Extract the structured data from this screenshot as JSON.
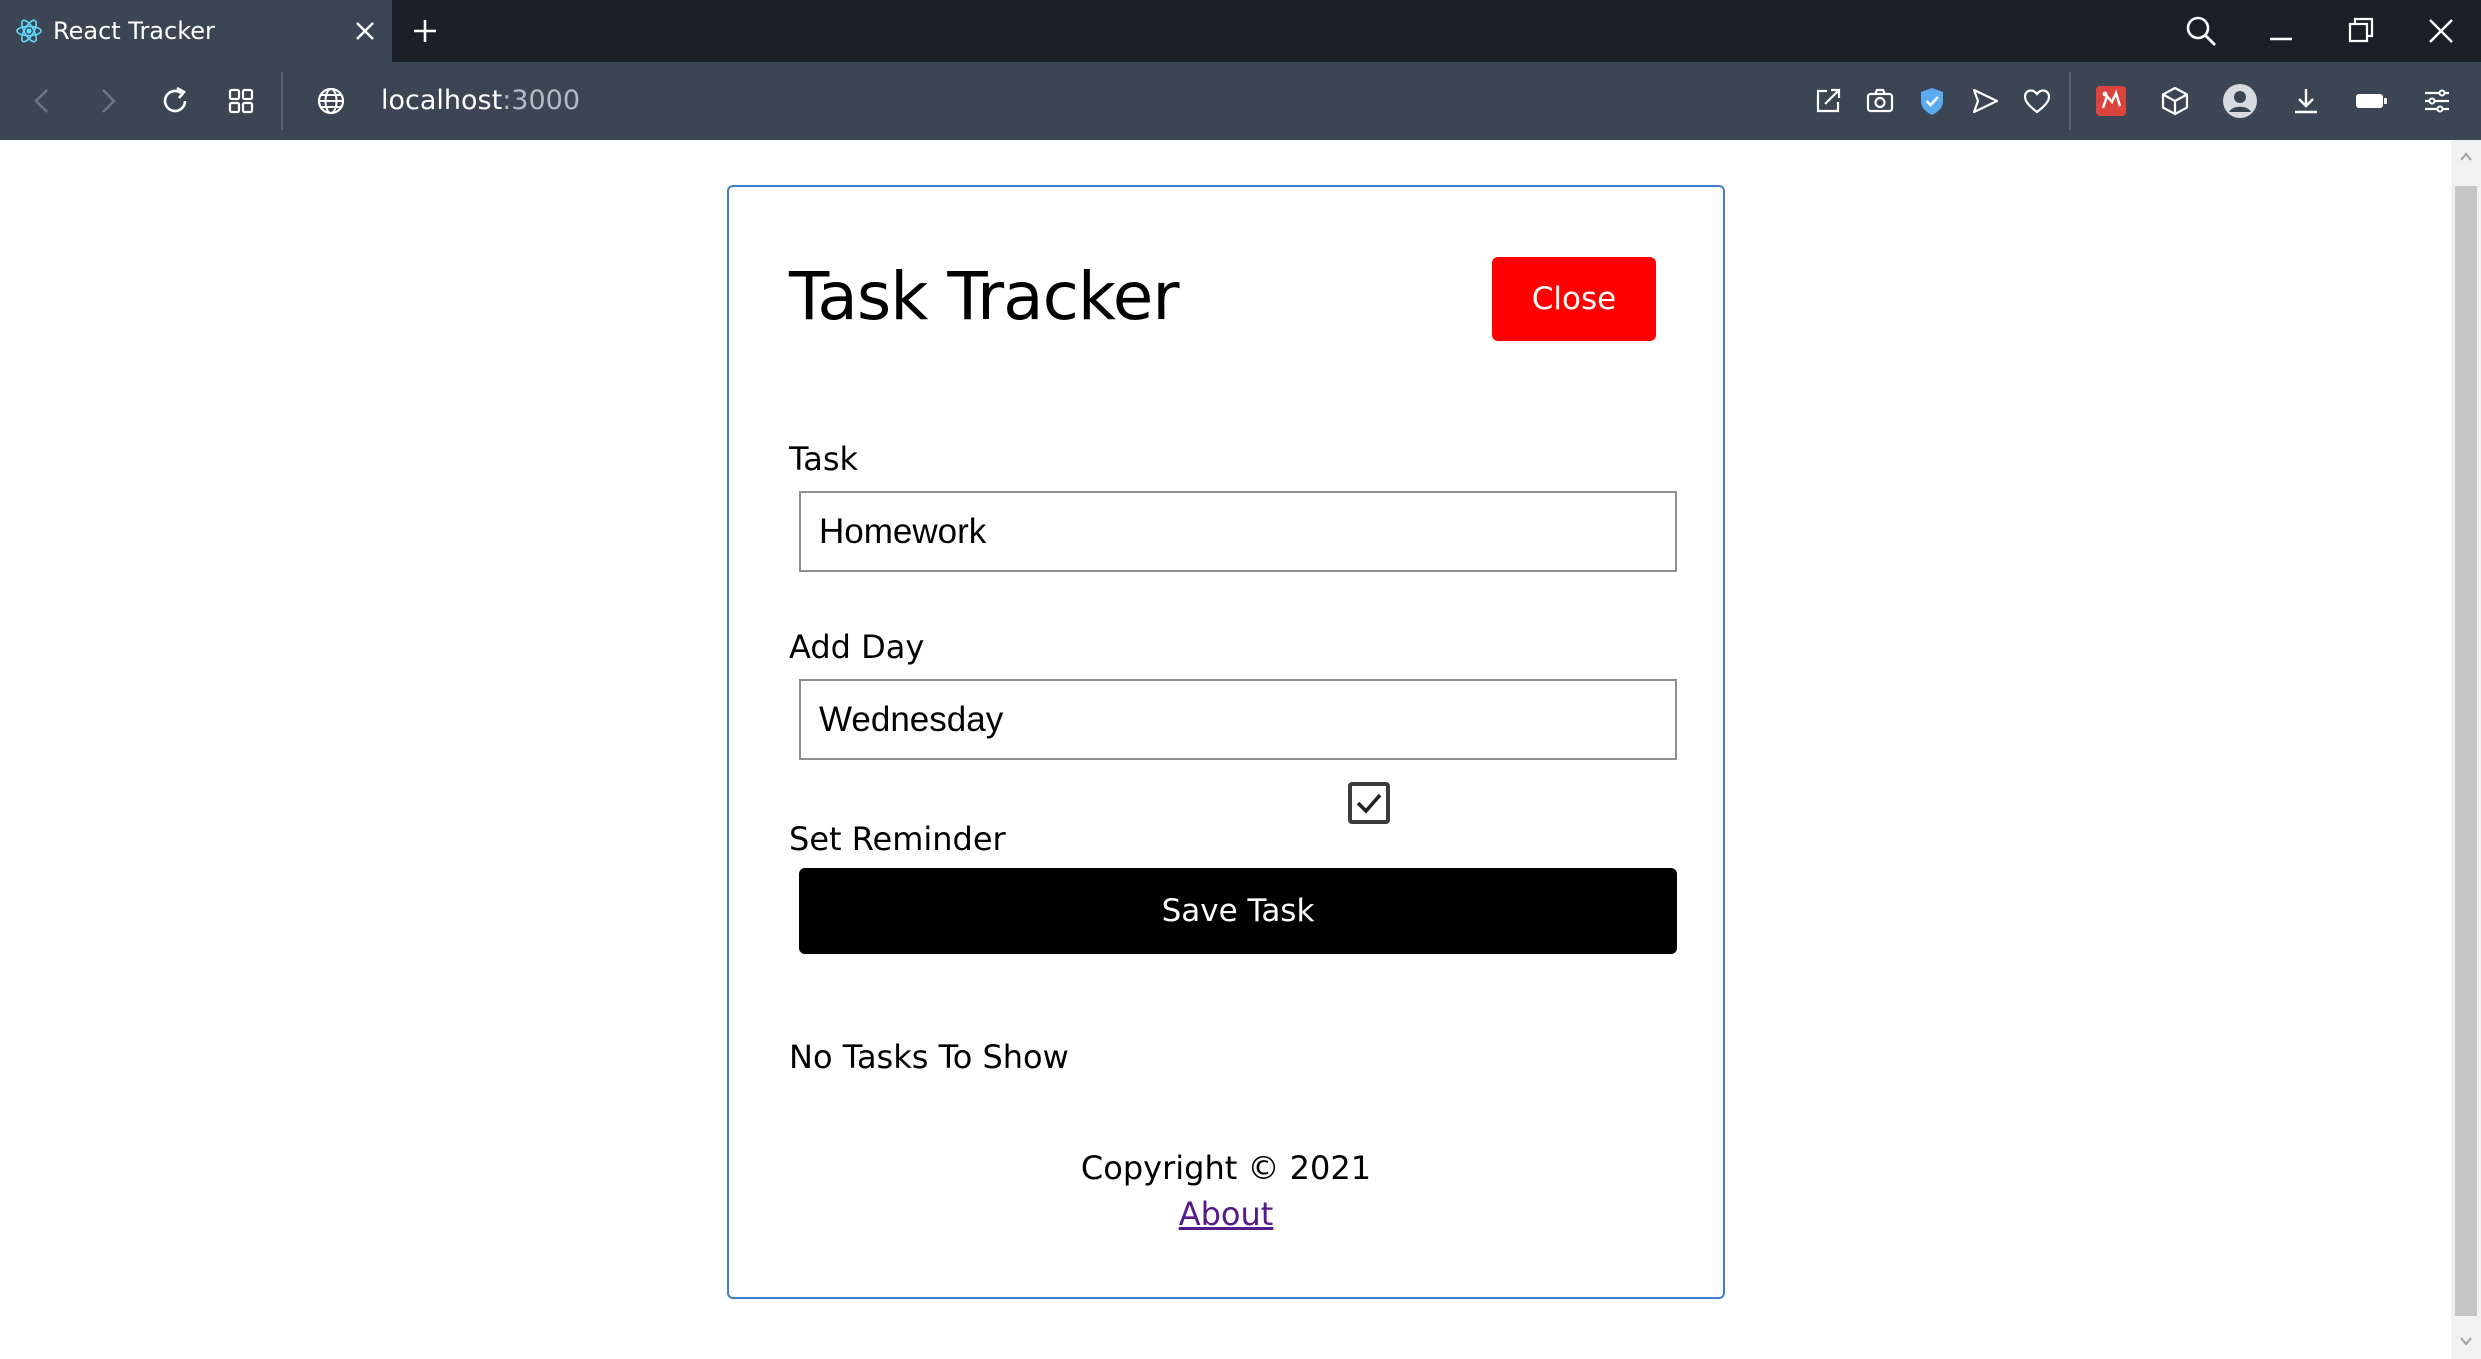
{
  "browser": {
    "tab": {
      "title": "React Tracker",
      "favicon": "react-logo-icon"
    },
    "address": {
      "host": "localhost",
      "port": ":3000"
    },
    "colors": {
      "tab_bg": "#3c4554",
      "strip_bg": "#1c1f26"
    }
  },
  "app": {
    "title": "Task Tracker",
    "close_button": "Close",
    "form": {
      "task_label": "Task",
      "task_value": "Homework",
      "day_label": "Add Day",
      "day_value": "Wednesday",
      "reminder_label": "Set Reminder",
      "reminder_checked": true,
      "save_button": "Save Task"
    },
    "empty_message": "No Tasks To Show",
    "footer": {
      "copyright": "Copyright © 2021",
      "about_link": "About"
    },
    "colors": {
      "close_button": "#ff0000",
      "save_button": "#000000",
      "border": "#3f7ec9",
      "link": "#551a8b"
    }
  }
}
